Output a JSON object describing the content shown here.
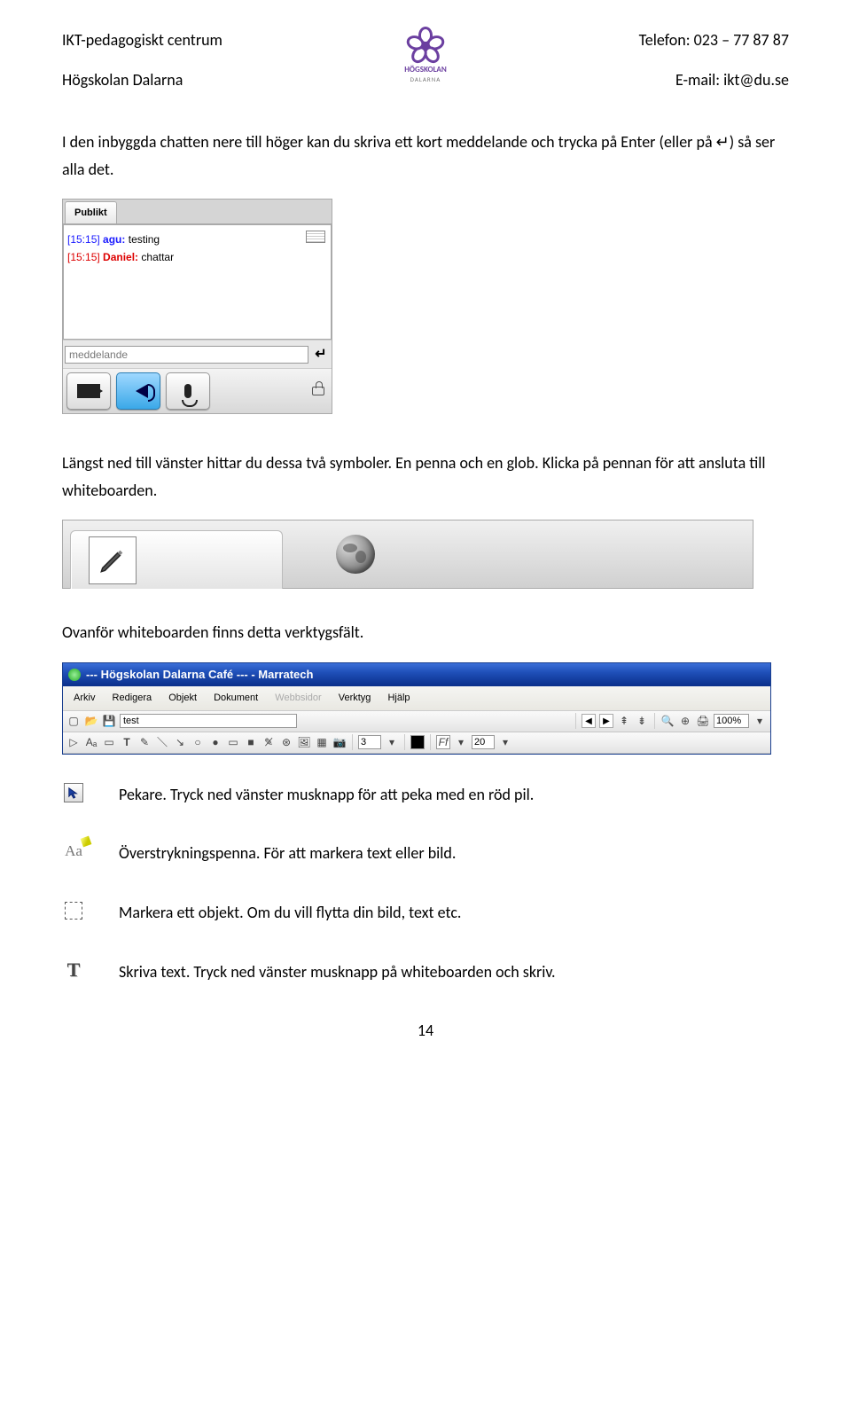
{
  "header": {
    "left_line1": "IKT-pedagogiskt centrum",
    "left_line2": "Högskolan Dalarna",
    "right_line1": "Telefon: 023 – 77 87 87",
    "right_line2": "E-mail: ikt@du.se",
    "logo_name": "HÖGSKOLAN",
    "logo_sub": "DALARNA"
  },
  "para1": "I den inbyggda chatten nere till höger kan du skriva ett kort meddelande och trycka på Enter (eller på ↵) så ser alla det.",
  "chat": {
    "tab": "Publikt",
    "line1_time": "[15:15]",
    "line1_user": "agu:",
    "line1_text": "testing",
    "line2_time": "[15:15]",
    "line2_user": "Daniel:",
    "line2_text": "chattar",
    "input_value": "meddelande",
    "enter_symbol": "↵"
  },
  "para2": "Längst ned till vänster hittar du dessa två symboler. En penna och en glob. Klicka på pennan för att ansluta till whiteboarden.",
  "para3": "Ovanför whiteboarden finns detta verktygsfält.",
  "app": {
    "title": "--- Högskolan Dalarna Café --- - Marratech",
    "menu": [
      "Arkiv",
      "Redigera",
      "Objekt",
      "Dokument",
      "Webbsidor",
      "Verktyg",
      "Hjälp"
    ],
    "menu_disabled_index": 4,
    "doc_name": "test",
    "page_num": "3",
    "font_size": "20",
    "zoom": "100%"
  },
  "tools": {
    "pointer": "Pekare. Tryck ned vänster musknapp för att peka med en röd pil.",
    "highlighter": "Överstrykningspenna. För att markera text eller bild.",
    "marquee": "Markera ett objekt. Om du vill flytta din bild, text etc.",
    "text": "Skriva text. Tryck ned vänster musknapp på whiteboarden och skriv."
  },
  "page_number": "14"
}
